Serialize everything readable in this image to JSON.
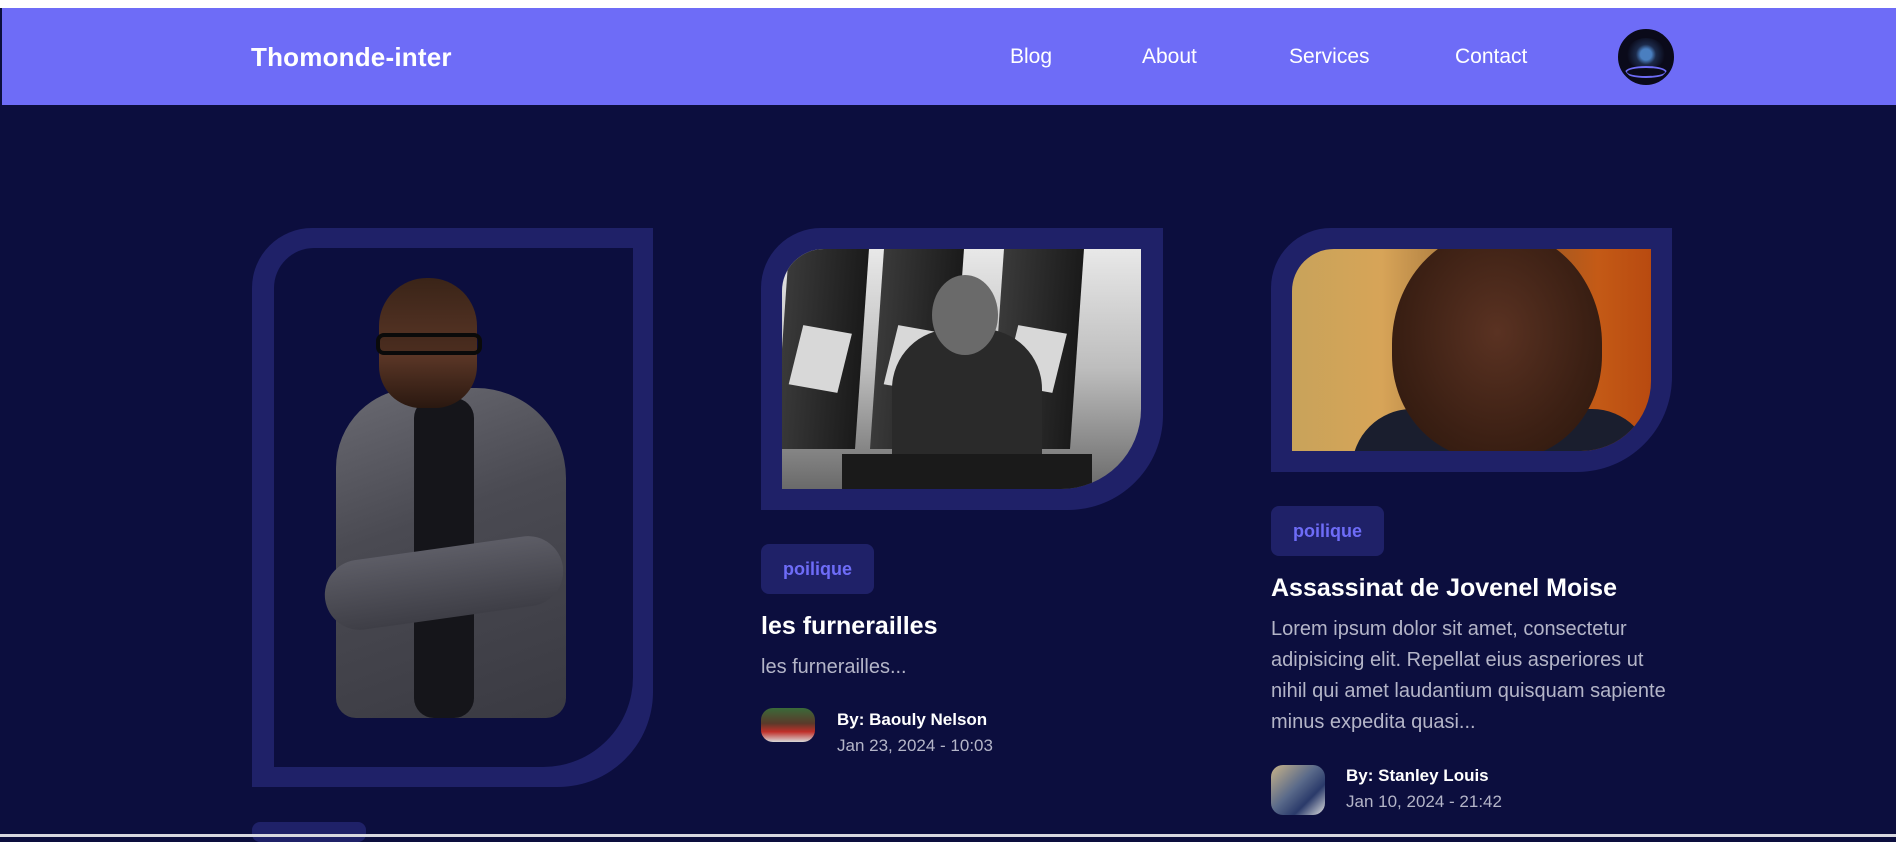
{
  "brand": "Thomonde-inter",
  "nav": {
    "links": [
      "Blog",
      "About",
      "Services",
      "Contact"
    ]
  },
  "posts": [
    {
      "tag": "poilique",
      "title": "les furnerailles",
      "excerpt": "les furnerailles...",
      "author": "By: Baouly Nelson",
      "date": "Jan 23, 2024 - 10:03"
    },
    {
      "tag": "poilique",
      "title": "Assassinat de Jovenel Moise",
      "excerpt": "Lorem ipsum dolor sit amet, consectetur adipisicing elit. Repellat eius asperiores ut nihil qui amet laudantium quisquam sapiente minus expedita quasi...",
      "author": "By: Stanley Louis",
      "date": "Jan 10, 2024 - 21:42"
    }
  ],
  "colors": {
    "navbar": "#6e6cf7",
    "background": "#0c0e3e",
    "frame": "#1f2168",
    "accent": "#6e6cf7",
    "muted_text": "#b4b5c8"
  }
}
